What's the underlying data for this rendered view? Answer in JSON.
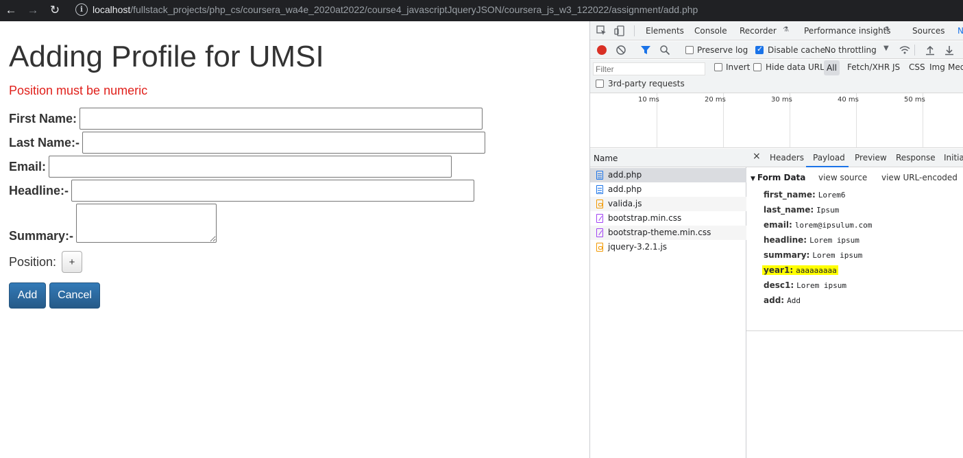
{
  "browser": {
    "url_host": "localhost",
    "url_path": "/fullstack_projects/php_cs/coursera_wa4e_2020at2022/course4_javascriptJqueryJSON/coursera_js_w3_122022/assignment/add.php"
  },
  "page": {
    "title": "Adding Profile for UMSI",
    "error": "Position must be numeric",
    "fields": {
      "first_name": "First Name:",
      "last_name": "Last Name:-",
      "email": "Email:",
      "headline": "Headline:-",
      "summary": "Summary:-",
      "position": "Position:"
    },
    "plus_label": "+",
    "add_label": "Add",
    "cancel_label": "Cancel"
  },
  "devtools": {
    "tabs": [
      "Elements",
      "Console",
      "Recorder",
      "Performance insights",
      "Sources",
      "N"
    ],
    "preserve_log": "Preserve log",
    "disable_cache": "Disable cache",
    "throttling": "No throttling",
    "filter_placeholder": "Filter",
    "invert": "Invert",
    "hide_data_urls": "Hide data URLs",
    "types": [
      "All",
      "Fetch/XHR",
      "JS",
      "CSS",
      "Img",
      "Med"
    ],
    "third_party": "3rd-party requests",
    "timeline_ticks": [
      "10 ms",
      "20 ms",
      "30 ms",
      "40 ms",
      "50 ms"
    ],
    "name_header": "Name",
    "requests": [
      {
        "name": "add.php",
        "type": "doc"
      },
      {
        "name": "add.php",
        "type": "doc"
      },
      {
        "name": "valida.js",
        "type": "js"
      },
      {
        "name": "bootstrap.min.css",
        "type": "css"
      },
      {
        "name": "bootstrap-theme.min.css",
        "type": "css"
      },
      {
        "name": "jquery-3.2.1.js",
        "type": "js"
      }
    ],
    "detail_tabs": [
      "×",
      "Headers",
      "Payload",
      "Preview",
      "Response",
      "Initiat"
    ],
    "form_data_title": "Form Data",
    "view_source": "view source",
    "view_url_encoded": "view URL-encoded",
    "form_data": [
      {
        "key": "first_name:",
        "value": "Lorem6"
      },
      {
        "key": "last_name:",
        "value": "Ipsum"
      },
      {
        "key": "email:",
        "value": "lorem@ipsulum.com"
      },
      {
        "key": "headline:",
        "value": "Lorem ipsum"
      },
      {
        "key": "summary:",
        "value": "Lorem ipsum"
      },
      {
        "key": "year1:",
        "value": "aaaaaaaaa"
      },
      {
        "key": "desc1:",
        "value": "Lorem ipsum"
      },
      {
        "key": "add:",
        "value": "Add"
      }
    ]
  }
}
